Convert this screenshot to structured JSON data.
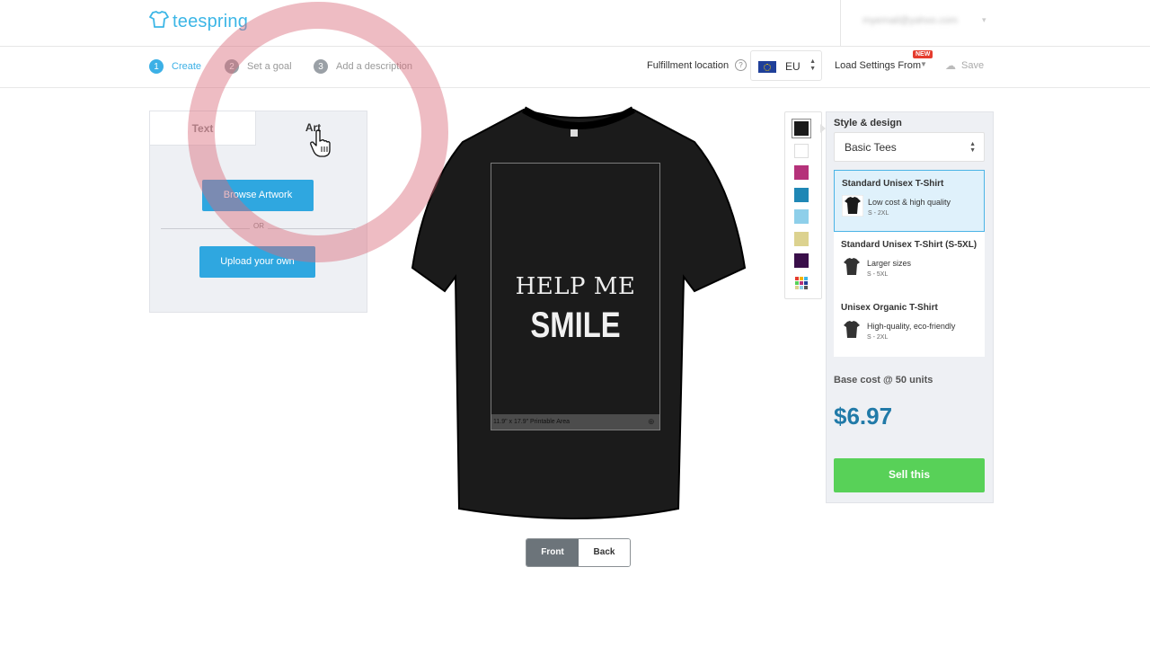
{
  "header": {
    "brand": "teespring",
    "user_email": "myemail@yahoo.com"
  },
  "steps": [
    {
      "num": "1",
      "label": "Create",
      "active": true
    },
    {
      "num": "2",
      "label": "Set a goal",
      "active": false
    },
    {
      "num": "3",
      "label": "Add a description",
      "active": false
    }
  ],
  "toolbar": {
    "fulfillment_label": "Fulfillment location",
    "fulfillment_value": "EU",
    "load_settings_label": "Load Settings From",
    "new_badge": "NEW",
    "save_label": "Save"
  },
  "left_panel": {
    "tabs": [
      {
        "label": "Text",
        "active": false
      },
      {
        "label": "Art",
        "active": true
      }
    ],
    "browse_label": "Browse Artwork",
    "or_label": "OR",
    "upload_label": "Upload your own"
  },
  "canvas": {
    "design_line1": "HELP ME",
    "design_line2": "SMILE",
    "printable_area_label": "11.9\" x 17.9\" Printable Area",
    "shirt_color": "#1b1b1b"
  },
  "view_toggle": {
    "front_label": "Front",
    "back_label": "Back",
    "active": "Front"
  },
  "swatches": [
    "#1a1a1a",
    "#ffffff",
    "#b5327a",
    "#1f87b5",
    "#8ecfea",
    "#dcd28f",
    "#3a0f4a",
    "multicolor"
  ],
  "selected_swatch": 0,
  "style_panel": {
    "label": "Style & design",
    "category": "Basic Tees",
    "products": [
      {
        "title": "Standard Unisex T-Shirt",
        "desc": "Low cost & high quality",
        "sizes": "S - 2XL",
        "selected": true
      },
      {
        "title": "Standard Unisex T-Shirt (S-5XL)",
        "desc": "Larger sizes",
        "sizes": "S - 5XL",
        "selected": false
      },
      {
        "title": "Unisex Organic T-Shirt",
        "desc": "High-quality, eco-friendly",
        "sizes": "S - 2XL",
        "selected": false
      }
    ],
    "base_cost_label": "Base cost @ 50 units",
    "price": "$6.97",
    "sell_label": "Sell this"
  },
  "colors": {
    "accent": "#2fa7e0",
    "sell": "#58d158",
    "price": "#217aa8"
  }
}
